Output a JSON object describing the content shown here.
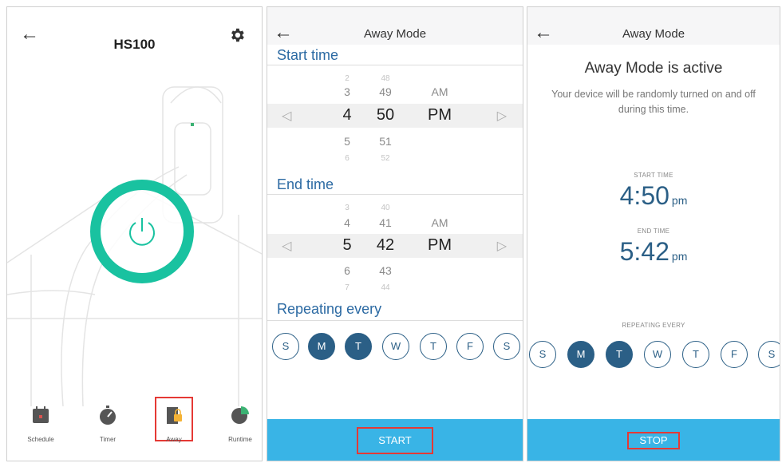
{
  "panel1": {
    "title": "HS100",
    "icons": {
      "back": "back-arrow-icon",
      "settings": "gear-icon",
      "power": "power-icon"
    },
    "nav": [
      {
        "label": "Schedule",
        "icon": "calendar-icon"
      },
      {
        "label": "Timer",
        "icon": "stopwatch-icon"
      },
      {
        "label": "Away",
        "icon": "away-icon"
      },
      {
        "label": "Runtime",
        "icon": "pie-chart-icon"
      }
    ],
    "colors": {
      "power_ring": "#19c2a0",
      "highlight": "#e53935"
    }
  },
  "panel2": {
    "title": "Away Mode",
    "start_section": "Start time",
    "start_picker": {
      "rows": [
        {
          "h": "2",
          "m": "48",
          "ap": ""
        },
        {
          "h": "3",
          "m": "49",
          "ap": "AM"
        },
        {
          "h": "4",
          "m": "50",
          "ap": "PM"
        },
        {
          "h": "5",
          "m": "51",
          "ap": ""
        },
        {
          "h": "6",
          "m": "52",
          "ap": ""
        }
      ]
    },
    "end_section": "End time",
    "end_picker": {
      "rows": [
        {
          "h": "3",
          "m": "40",
          "ap": ""
        },
        {
          "h": "4",
          "m": "41",
          "ap": "AM"
        },
        {
          "h": "5",
          "m": "42",
          "ap": "PM"
        },
        {
          "h": "6",
          "m": "43",
          "ap": ""
        },
        {
          "h": "7",
          "m": "44",
          "ap": ""
        }
      ]
    },
    "caret_left": "◁",
    "caret_right": "▷",
    "repeat_section": "Repeating every",
    "days": [
      {
        "label": "S",
        "on": false
      },
      {
        "label": "M",
        "on": true
      },
      {
        "label": "T",
        "on": true
      },
      {
        "label": "W",
        "on": false
      },
      {
        "label": "T",
        "on": false
      },
      {
        "label": "F",
        "on": false
      },
      {
        "label": "S",
        "on": false
      }
    ],
    "start_button": "START",
    "colors": {
      "accent": "#2b5f86",
      "bar": "#39b4e6"
    }
  },
  "panel3": {
    "title": "Away Mode",
    "heading": "Away Mode is active",
    "description": "Your device will be randomly turned on and off during this time.",
    "start_label": "START TIME",
    "start_time": "4:50",
    "start_unit": "pm",
    "end_label": "END TIME",
    "end_time": "5:42",
    "end_unit": "pm",
    "repeat_label": "REPEATING EVERY",
    "days": [
      {
        "label": "S",
        "on": false
      },
      {
        "label": "M",
        "on": true
      },
      {
        "label": "T",
        "on": true
      },
      {
        "label": "W",
        "on": false
      },
      {
        "label": "T",
        "on": false
      },
      {
        "label": "F",
        "on": false
      },
      {
        "label": "S",
        "on": false
      }
    ],
    "stop_button": "STOP"
  }
}
